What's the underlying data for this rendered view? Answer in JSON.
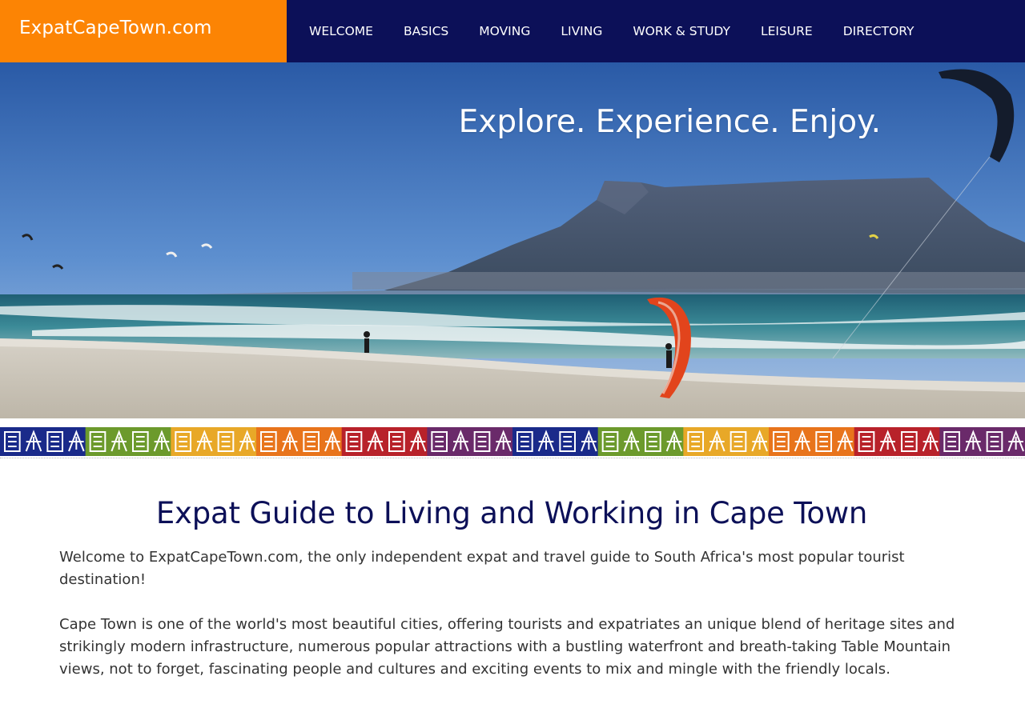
{
  "site": {
    "logo_text": "ExpatCapeTown.com"
  },
  "nav": {
    "items": [
      {
        "label": "WELCOME"
      },
      {
        "label": "BASICS"
      },
      {
        "label": "MOVING"
      },
      {
        "label": "LIVING"
      },
      {
        "label": "WORK & STUDY"
      },
      {
        "label": "LEISURE"
      },
      {
        "label": "DIRECTORY"
      }
    ]
  },
  "hero": {
    "tagline": "Explore. Experience. Enjoy."
  },
  "colors": {
    "brand_orange": "#fc8404",
    "navy": "#0c1058",
    "pattern": [
      "#1a2a8a",
      "#6c9a2c",
      "#e8a828",
      "#e8741c",
      "#b8222a",
      "#6a2a6a"
    ]
  },
  "main": {
    "title": "Expat Guide to Living and Working in Cape Town",
    "paragraphs": [
      "Welcome to ExpatCapeTown.com, the only independent expat and travel guide to South Africa's most popular tourist destination!",
      "Cape Town is one of the world's most beautiful cities, offering tourists and expatriates an unique blend of heritage sites and strikingly modern infrastructure, numerous popular attractions with a bustling waterfront and breath-taking Table Mountain views, not to forget, fascinating people and cultures and exciting events to mix and mingle with the friendly locals."
    ]
  }
}
